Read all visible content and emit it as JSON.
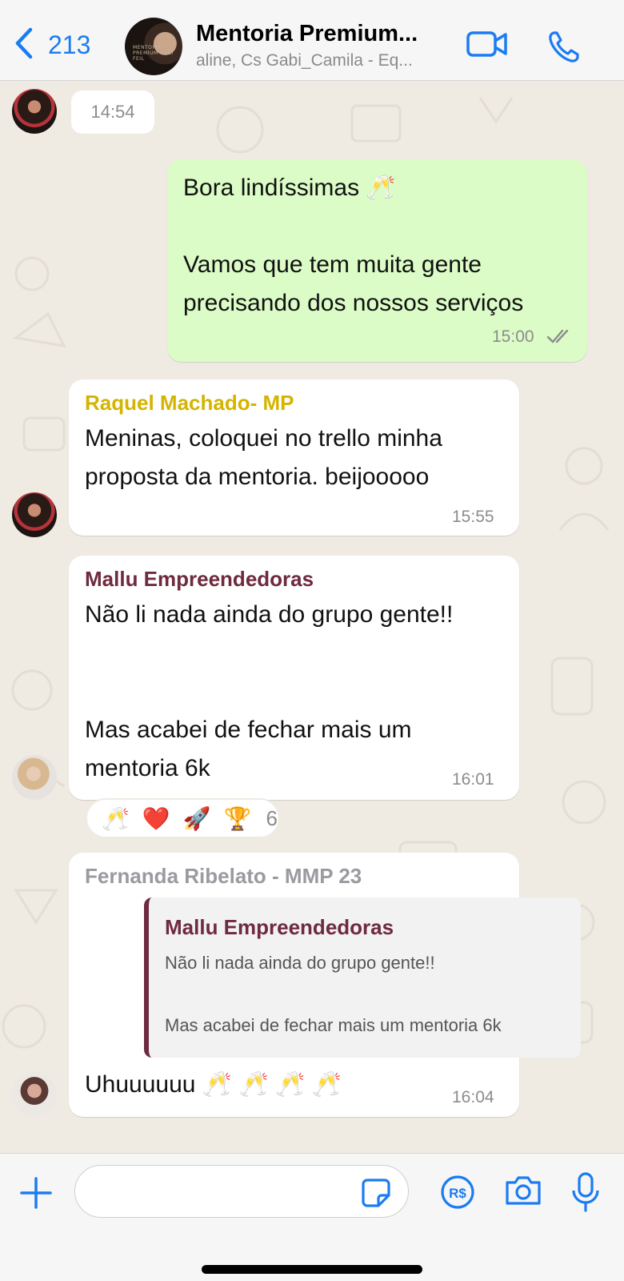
{
  "header": {
    "back_count": "213",
    "title": "Mentoria Premium...",
    "subtitle": "aline, Cs Gabi_Camila - Eq...",
    "avatar_text": "MENTORIA PREMIUM GABI FEIL"
  },
  "chat": {
    "time_chip": "14:54",
    "outgoing": {
      "text": "Bora lindíssimas 🥂\n\nVamos que tem muita gente\nprecisando dos nossos serviços",
      "time": "15:00",
      "status": "read-double-check"
    },
    "msg_raquel": {
      "sender": "Raquel Machado- MP",
      "sender_color": "#d4b400",
      "text": "Meninas, coloquei no trello minha\nproposta da mentoria. beijooooo",
      "time": "15:55"
    },
    "msg_mallu": {
      "sender": "Mallu Empreendedoras",
      "sender_color": "#6e2a3e",
      "text": "Não li nada ainda do grupo gente!!\n\n\nMas acabei de fechar mais um\nmentoria 6k",
      "time": "16:01",
      "reactions": [
        "🥂",
        "❤️",
        "🚀",
        "🏆"
      ],
      "reaction_count": "6"
    },
    "msg_fernanda": {
      "sender": "Fernanda Ribelato - MMP 23",
      "sender_color": "#9a9aa0",
      "quote_sender": "Mallu Empreendedoras",
      "quote_text": "Não li nada ainda do grupo gente!!\n\nMas acabei de fechar mais um mentoria 6k",
      "text": "Uhuuuuuu 🥂 🥂 🥂 🥂",
      "time": "16:04"
    }
  },
  "composer": {
    "input_value": "",
    "pay_label": "R$"
  },
  "colors": {
    "accent": "#1a7cf2",
    "outgoing_bubble": "#dbfcc6",
    "chat_background": "#efeae2"
  }
}
